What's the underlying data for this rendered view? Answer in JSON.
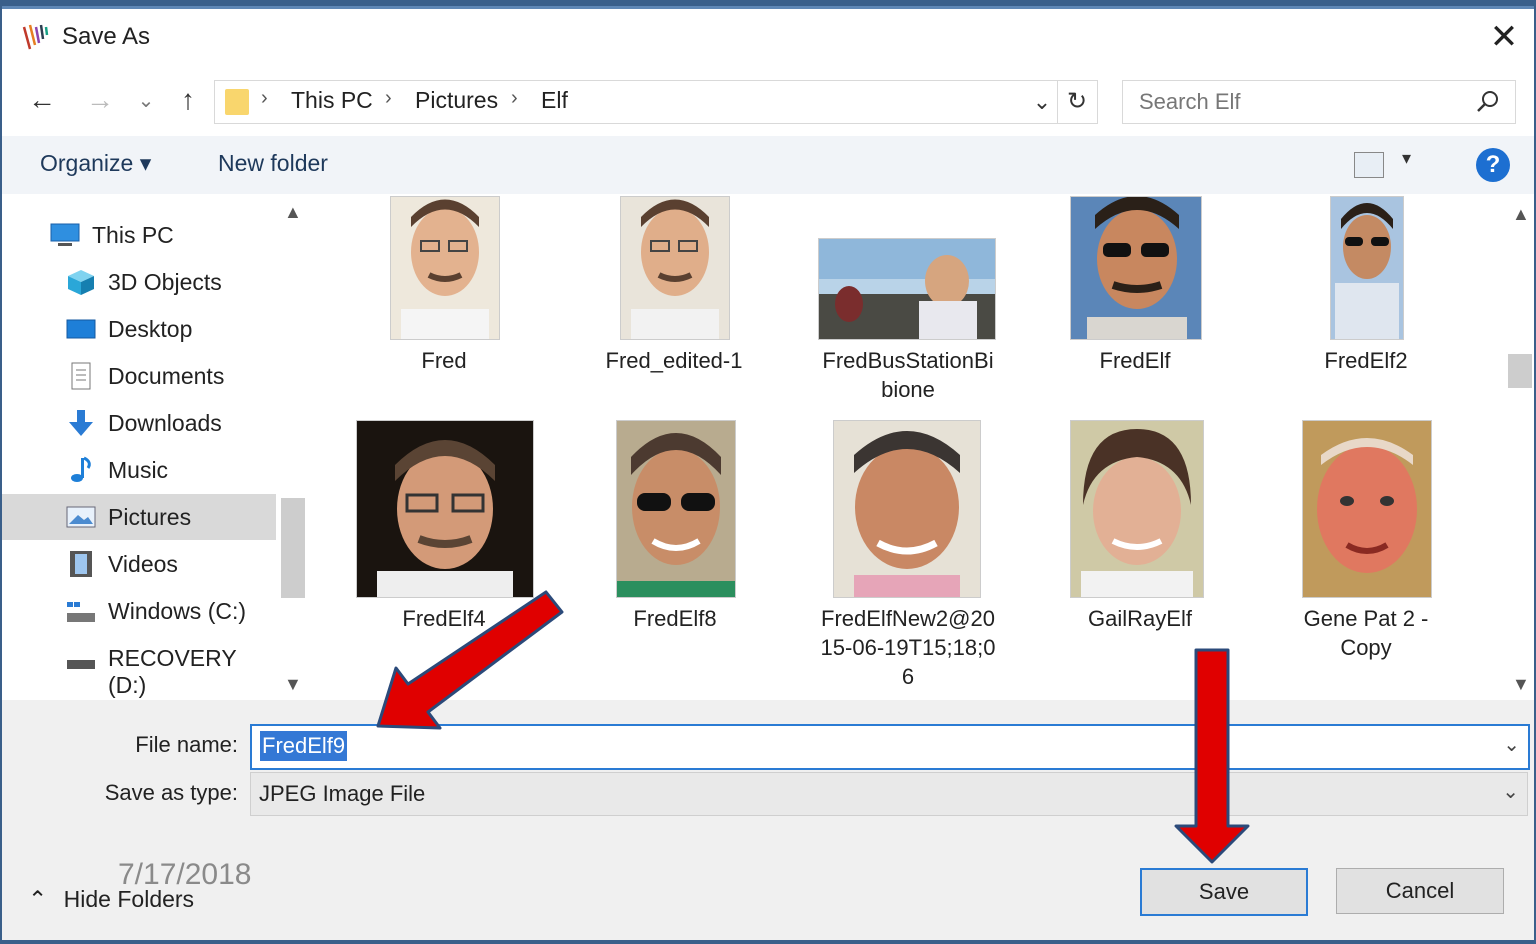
{
  "window": {
    "title": "Save As",
    "close_glyph": "✕"
  },
  "nav_buttons": {
    "back": "←",
    "forward": "→",
    "recent": "⌄",
    "up": "↑"
  },
  "address": {
    "crumbs": [
      "This PC",
      "Pictures",
      "Elf"
    ],
    "separator": "›",
    "dropdown_glyph": "⌄",
    "refresh_glyph": "↻"
  },
  "search": {
    "placeholder": "Search Elf"
  },
  "toolbar": {
    "organize": "Organize ▾",
    "new_folder": "New folder",
    "help": "?",
    "view_dd": "▾"
  },
  "sidebar": {
    "items": [
      {
        "label": "This PC",
        "icon": "computer-icon"
      },
      {
        "label": "3D Objects",
        "icon": "cube-icon"
      },
      {
        "label": "Desktop",
        "icon": "desktop-icon"
      },
      {
        "label": "Documents",
        "icon": "document-icon"
      },
      {
        "label": "Downloads",
        "icon": "download-icon"
      },
      {
        "label": "Music",
        "icon": "music-icon"
      },
      {
        "label": "Pictures",
        "icon": "pictures-icon",
        "selected": true
      },
      {
        "label": "Videos",
        "icon": "video-icon"
      },
      {
        "label": "Windows (C:)",
        "icon": "drive-icon"
      },
      {
        "label": "RECOVERY (D:)",
        "icon": "drive-icon"
      }
    ]
  },
  "files": [
    {
      "name": "Fred"
    },
    {
      "name": "Fred_edited-1"
    },
    {
      "name": "FredBusStationBi",
      "name2": "bione"
    },
    {
      "name": "FredElf"
    },
    {
      "name": "FredElf2"
    },
    {
      "name": "FredElf4"
    },
    {
      "name": "FredElf8"
    },
    {
      "name": "FredElfNew2@20",
      "name2": "15-06-19T15;18;0",
      "name3": "6"
    },
    {
      "name": "GailRayElf"
    },
    {
      "name": "Gene Pat 2 -",
      "name2": "Copy"
    }
  ],
  "form": {
    "file_name_label": "File name:",
    "file_name_value": "FredElf9",
    "save_type_label": "Save as type:",
    "save_type_value": "JPEG Image File",
    "dd_glyph": "⌄"
  },
  "buttons": {
    "save": "Save",
    "cancel": "Cancel"
  },
  "hide_folders": "Hide Folders",
  "hide_folders_glyph": "⌃",
  "date_stamp": "7/17/2018",
  "colors": {
    "selection": "#3478d5",
    "arrow": "#e00000",
    "arrow_outline": "#2b4a7a",
    "help": "#1d6fd1"
  }
}
